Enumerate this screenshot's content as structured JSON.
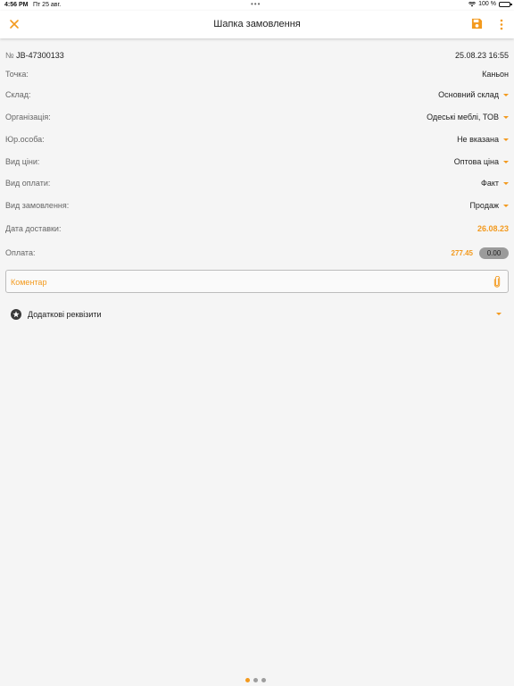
{
  "status_bar": {
    "time": "4:56 PM",
    "date": "Пт 25 авг.",
    "battery": "100 %"
  },
  "header": {
    "title": "Шапка замовлення",
    "close_icon": "close-icon",
    "save_icon": "save-icon",
    "more_icon": "more-icon"
  },
  "order": {
    "number_sign": "№",
    "number": "JB-47300133",
    "datetime": "25.08.23 16:55"
  },
  "fields": [
    {
      "label": "Точка:",
      "value": "Каньон",
      "dropdown": false
    },
    {
      "label": "Склад:",
      "value": "Основний склад",
      "dropdown": true
    },
    {
      "label": "Організація:",
      "value": "Одеські меблі, ТОВ",
      "dropdown": true
    },
    {
      "label": "Юр.особа:",
      "value": "Не вказана",
      "dropdown": true
    },
    {
      "label": "Вид ціни:",
      "value": "Оптова ціна",
      "dropdown": true
    },
    {
      "label": "Вид оплати:",
      "value": "Факт",
      "dropdown": true
    },
    {
      "label": "Вид замовлення:",
      "value": "Продаж",
      "dropdown": true
    }
  ],
  "delivery": {
    "label": "Дата доставки:",
    "value": "26.08.23"
  },
  "payment": {
    "label": "Оплата:",
    "total": "277.45",
    "paid": "0.00"
  },
  "comment": {
    "placeholder": "Коментар"
  },
  "extra": {
    "label": "Додаткові реквізити"
  },
  "pager": {
    "pages": 3,
    "active": 0
  },
  "colors": {
    "accent": "#f39a1e",
    "background": "#f5f5f5"
  }
}
